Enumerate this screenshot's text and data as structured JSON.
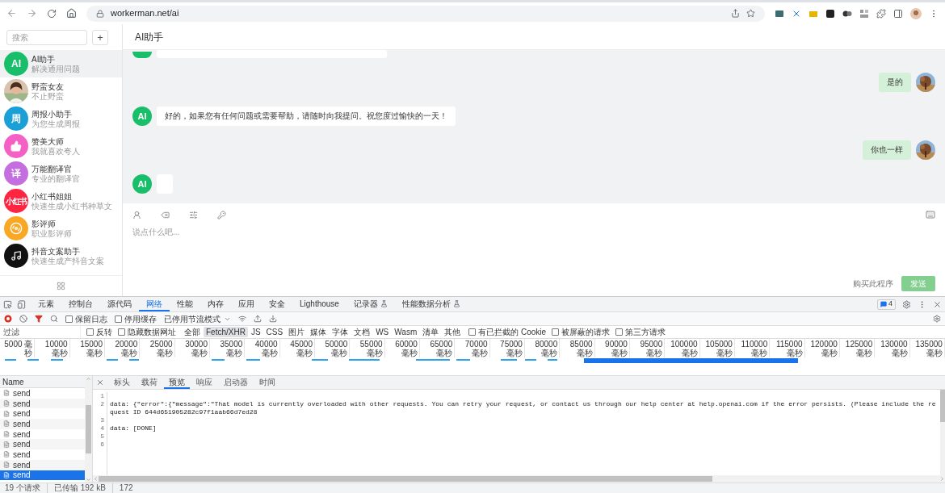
{
  "browser": {
    "url": "workerman.net/ai"
  },
  "sidebar": {
    "search": {
      "placeholder": "搜索"
    },
    "add_button": "+",
    "contacts": [
      {
        "name": "AI助手",
        "subtitle": "解决通用问题",
        "avatar": {
          "kind": "text",
          "text": "AI"
        },
        "color": "#19be6b",
        "selected": true
      },
      {
        "name": "野蛮女友",
        "subtitle": "不止野蛮",
        "selected": false
      },
      {
        "name": "周报小助手",
        "subtitle": "为您生成周报",
        "avatar": {
          "kind": "text",
          "text": "周"
        },
        "color": "#1a9fd6",
        "selected": false
      },
      {
        "name": "赞美大师",
        "subtitle": "我就喜欢夸人",
        "avatar": {
          "kind": "thumb"
        },
        "color": "#f560c4",
        "selected": false
      },
      {
        "name": "万能翻译官",
        "subtitle": "专业的翻译官",
        "avatar": {
          "kind": "text",
          "text": "译"
        },
        "color": "#c56ee0",
        "selected": false
      },
      {
        "name": "小红书姐姐",
        "subtitle": "快速生成小红书种草文",
        "avatar": {
          "kind": "text",
          "text": "小红书"
        },
        "color": "#ff2442",
        "selected": false
      },
      {
        "name": "影评师",
        "subtitle": "职业影评师",
        "avatar": {
          "kind": "film"
        },
        "color": "#f9a825",
        "selected": false
      },
      {
        "name": "抖音文案助手",
        "subtitle": "快速生成产抖音文案",
        "avatar": {
          "kind": "note"
        },
        "color": "#111111",
        "selected": false
      }
    ]
  },
  "chat": {
    "title": "AI助手",
    "messages": [
      {
        "kind": "ai_cut"
      },
      {
        "kind": "user",
        "text": "是的"
      },
      {
        "kind": "ai",
        "avatar": "AI",
        "text": "好的，如果您有任何问题或需要帮助，请随时向我提问。祝您度过愉快的一天！"
      },
      {
        "kind": "user",
        "text": "你也一样"
      },
      {
        "kind": "ai",
        "avatar": "AI"
      }
    ],
    "input": {
      "placeholder": "说点什么吧..."
    },
    "buy_link": "购买此程序",
    "send_button": "发送"
  },
  "devtools": {
    "tabs": [
      {
        "label": "元素",
        "selected": false,
        "experimental": false
      },
      {
        "label": "控制台",
        "selected": false,
        "experimental": false
      },
      {
        "label": "源代码",
        "selected": false,
        "experimental": false
      },
      {
        "label": "网络",
        "selected": true,
        "experimental": false
      },
      {
        "label": "性能",
        "selected": false,
        "experimental": false
      },
      {
        "label": "内存",
        "selected": false,
        "experimental": false
      },
      {
        "label": "应用",
        "selected": false,
        "experimental": false
      },
      {
        "label": "安全",
        "selected": false,
        "experimental": false
      },
      {
        "label": "Lighthouse",
        "selected": false,
        "experimental": false
      },
      {
        "label": "记录器",
        "selected": false,
        "experimental": true
      },
      {
        "label": "性能数据分析",
        "selected": false,
        "experimental": true
      }
    ],
    "issues_badge": "4",
    "toolbar": {
      "checkboxes": [
        {
          "label": "保留日志",
          "checked": false
        },
        {
          "label": "停用缓存",
          "checked": false
        }
      ],
      "throttling": "已停用节流模式"
    },
    "filter": {
      "placeholder": "过滤",
      "options_before": [
        {
          "label": "反转",
          "checked": false
        },
        {
          "label": "隐藏数据网址",
          "checked": false
        }
      ],
      "types": [
        {
          "label": "全部",
          "selected": false
        },
        {
          "label": "Fetch/XHR",
          "selected": true
        },
        {
          "label": "JS",
          "selected": false
        },
        {
          "label": "CSS",
          "selected": false
        },
        {
          "label": "图片",
          "selected": false
        },
        {
          "label": "媒体",
          "selected": false
        },
        {
          "label": "字体",
          "selected": false
        },
        {
          "label": "文档",
          "selected": false
        },
        {
          "label": "WS",
          "selected": false
        },
        {
          "label": "Wasm",
          "selected": false
        },
        {
          "label": "清单",
          "selected": false
        },
        {
          "label": "其他",
          "selected": false
        }
      ],
      "options_after": [
        {
          "label": "有已拦截的 Cookie",
          "checked": false
        },
        {
          "label": "被屏蔽的请求",
          "checked": false
        },
        {
          "label": "第三方请求",
          "checked": false
        }
      ]
    },
    "timeline": {
      "ticks": [
        "5000 毫秒",
        "10000 毫秒",
        "15000 毫秒",
        "20000 毫秒",
        "25000 毫秒",
        "30000 毫秒",
        "35000 毫秒",
        "40000 毫秒",
        "45000 毫秒",
        "50000 毫秒",
        "55000 毫秒",
        "60000 毫秒",
        "65000 毫秒",
        "70000 毫秒",
        "75000 毫秒",
        "80000 毫秒",
        "85000 毫秒",
        "90000 毫秒",
        "95000 毫秒",
        "100000 毫秒",
        "105000 毫秒",
        "110000 毫秒",
        "115000 毫秒",
        "120000 毫秒",
        "125000 毫秒",
        "130000 毫秒",
        "135000 毫秒"
      ]
    },
    "requests": {
      "column": "Name",
      "rows": [
        {
          "name": "send",
          "selected": false
        },
        {
          "name": "send",
          "selected": false
        },
        {
          "name": "send",
          "selected": false
        },
        {
          "name": "send",
          "selected": false
        },
        {
          "name": "send",
          "selected": false
        },
        {
          "name": "send",
          "selected": false
        },
        {
          "name": "send",
          "selected": false
        },
        {
          "name": "send",
          "selected": false
        },
        {
          "name": "send",
          "selected": true
        }
      ]
    },
    "detail": {
      "tabs": [
        {
          "label": "标头",
          "selected": false
        },
        {
          "label": "载荷",
          "selected": false
        },
        {
          "label": "预览",
          "selected": true
        },
        {
          "label": "响应",
          "selected": false
        },
        {
          "label": "启动器",
          "selected": false
        },
        {
          "label": "时间",
          "selected": false
        }
      ],
      "lines": [
        {
          "number": "1"
        },
        {
          "number": "2",
          "text": "data: {\"error\":{\"message\":\"That model is currently overloaded with other requests. You can retry your request, or contact us through our help center at help.openai.com if the error persists. (Please include the request ID 644d651905282c97f1aab66d7ed28"
        },
        {
          "number": "3"
        },
        {
          "number": "4",
          "text": "data: [DONE]"
        },
        {
          "number": "5"
        },
        {
          "number": "6"
        }
      ]
    },
    "status_bar": [
      "19 个请求",
      "已传输 192 kB",
      "172"
    ]
  }
}
